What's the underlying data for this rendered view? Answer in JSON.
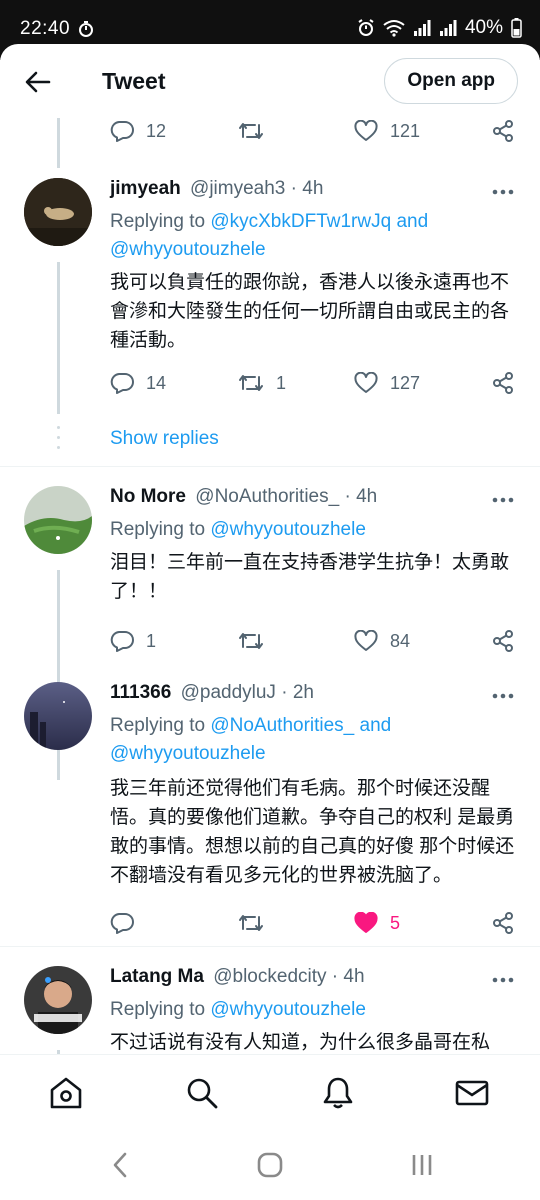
{
  "status_bar": {
    "time": "22:40",
    "battery": "40%"
  },
  "header": {
    "title": "Tweet",
    "open_app": "Open app"
  },
  "top_actions": {
    "reply": "12",
    "retweet": "",
    "like": "121"
  },
  "tweets": [
    {
      "name": "jimyeah",
      "handle": "@jimyeah3 · 4h",
      "replying_prefix": "Replying to ",
      "mentions": "@kycXbkDFTw1rwJq and @whyyoutouzhele",
      "text": "我可以負責任的跟你說，香港人以後永遠再也不會滲和大陸發生的任何一切所謂自由或民主的各種活動。",
      "reply": "14",
      "retweet": "1",
      "like": "127",
      "show_replies": "Show replies"
    },
    {
      "name": "No More",
      "handle": "@NoAuthorities_ · 4h",
      "replying_prefix": "Replying to ",
      "mentions": "@whyyoutouzhele",
      "text": "泪目！三年前一直在支持香港学生抗争！太勇敢了！！",
      "reply": "1",
      "retweet": "",
      "like": "84"
    },
    {
      "name": "111366",
      "handle": "@paddyluJ · 2h",
      "replying_prefix": "Replying to ",
      "mentions": "@NoAuthorities_ and @whyyoutouzhele",
      "text": "我三年前还觉得他们有毛病。那个时候还没醒悟。真的要像他们道歉。争夺自己的权利 是最勇敢的事情。想想以前的自己真的好傻 那个时候还不翻墙没有看见多元化的世界被洗脑了。",
      "reply": "",
      "retweet": "",
      "like": "5"
    },
    {
      "name": "Latang Ma",
      "handle": "@blockedcity · 4h",
      "replying_prefix": "Replying to ",
      "mentions": "@whyyoutouzhele",
      "text": "不过话说有没有人知道，为什么很多晶哥在私"
    }
  ],
  "colors": {
    "accent": "#1d9bf0",
    "like_active": "#f91880",
    "secondary_text": "#536471"
  },
  "icons": {
    "back": "back-arrow-icon",
    "more": "more-dots-icon",
    "reply": "reply-bubble-icon",
    "retweet": "retweet-icon",
    "like": "heart-icon",
    "share": "share-icon",
    "home": "home-icon",
    "search": "search-icon",
    "notifications": "bell-icon",
    "messages": "mail-icon"
  }
}
